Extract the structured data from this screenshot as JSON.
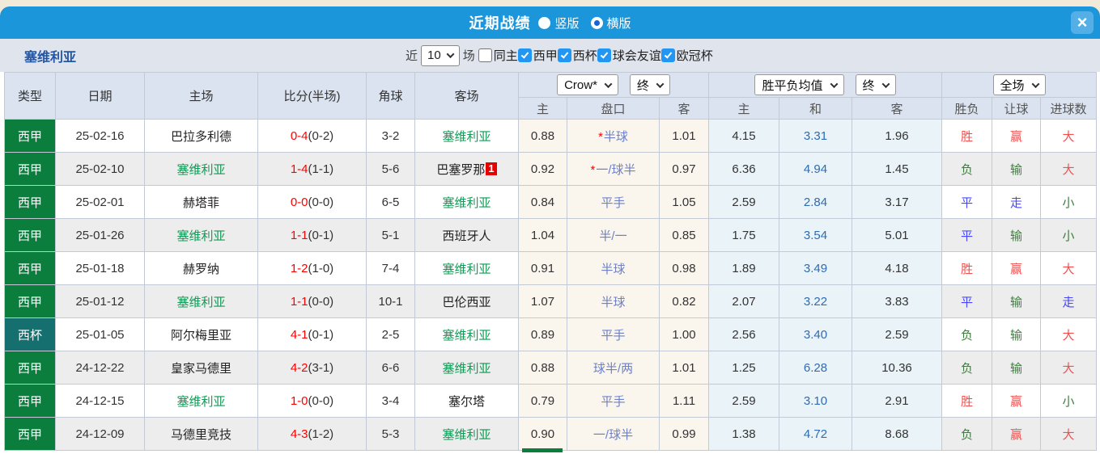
{
  "colors": {
    "titlebar_bg": "#1c96da",
    "close_bg": "#54afe6",
    "filter_bg": "#e0e4ed",
    "header_bg": "#dae3ef",
    "row_alt_bg": "#ededed",
    "ah_col_bg": "#faf6ee",
    "avg_col_bg": "#e9f3f8",
    "league_bg": "#0b7d3c",
    "cup_bg": "#156f6e",
    "team_green": "#119a55",
    "team_blue": "#2456a6",
    "score_red": "#ff0000",
    "star_red": "#ff0000",
    "handicap_blue": "#6d80c8",
    "avg_draw_blue": "#2f6cb3",
    "res_red": "#f34f4f",
    "res_green": "#3e7d3e",
    "res_blue": "#4646ff",
    "badge_red": "#e60000",
    "check_blue": "#2196f3",
    "radio_dot_blue": "#1565d8"
  },
  "titlebar": {
    "title": "近期战绩",
    "radios": [
      {
        "label": "竖版",
        "selected": false
      },
      {
        "label": "横版",
        "selected": true
      }
    ],
    "close_label": "×"
  },
  "filter": {
    "team": "塞维利亚",
    "recent_label": "近",
    "recent_value": "10",
    "matches_label": "场",
    "same_home": {
      "label": "同主",
      "checked": false
    },
    "leagues": [
      {
        "label": "西甲",
        "checked": true
      },
      {
        "label": "西杯",
        "checked": true
      },
      {
        "label": "球会友谊",
        "checked": true
      },
      {
        "label": "欧冠杯",
        "checked": true
      }
    ]
  },
  "table": {
    "static_headers": [
      "类型",
      "日期",
      "主场",
      "比分(半场)",
      "角球",
      "客场"
    ],
    "ah_group": {
      "company": "Crow*",
      "time": "终",
      "subs": [
        "主",
        "盘口",
        "客"
      ]
    },
    "avg_group": {
      "label": "胜平负均值",
      "time": "终",
      "subs": [
        "主",
        "和",
        "客"
      ]
    },
    "result_group": {
      "scope": "全场",
      "subs": [
        "胜负",
        "让球",
        "进球数"
      ]
    },
    "rows": [
      {
        "type": {
          "label": "西甲",
          "kind": "league"
        },
        "date": "25-02-16",
        "home": {
          "name": "巴拉多利德",
          "highlight": false
        },
        "score": {
          "full": "0-4",
          "half": "(0-2)"
        },
        "corners": "3-2",
        "away": {
          "name": "塞维利亚",
          "highlight": true,
          "badge": ""
        },
        "odds": {
          "home": "0.88",
          "line": "半球",
          "star": true,
          "away": "1.01"
        },
        "avg": {
          "home": "4.15",
          "draw": "3.31",
          "away": "1.96"
        },
        "result": {
          "wdl": {
            "t": "胜",
            "c": "red"
          },
          "ah": {
            "t": "赢",
            "c": "red"
          },
          "goal": {
            "t": "大",
            "c": "red"
          }
        }
      },
      {
        "type": {
          "label": "西甲",
          "kind": "league"
        },
        "date": "25-02-10",
        "home": {
          "name": "塞维利亚",
          "highlight": true
        },
        "score": {
          "full": "1-4",
          "half": "(1-1)"
        },
        "corners": "5-6",
        "away": {
          "name": "巴塞罗那",
          "highlight": false,
          "badge": "1"
        },
        "odds": {
          "home": "0.92",
          "line": "一/球半",
          "star": true,
          "away": "0.97"
        },
        "avg": {
          "home": "6.36",
          "draw": "4.94",
          "away": "1.45"
        },
        "result": {
          "wdl": {
            "t": "负",
            "c": "green"
          },
          "ah": {
            "t": "输",
            "c": "green"
          },
          "goal": {
            "t": "大",
            "c": "red"
          }
        }
      },
      {
        "type": {
          "label": "西甲",
          "kind": "league"
        },
        "date": "25-02-01",
        "home": {
          "name": "赫塔菲",
          "highlight": false
        },
        "score": {
          "full": "0-0",
          "half": "(0-0)"
        },
        "corners": "6-5",
        "away": {
          "name": "塞维利亚",
          "highlight": true,
          "badge": ""
        },
        "odds": {
          "home": "0.84",
          "line": "平手",
          "star": false,
          "away": "1.05"
        },
        "avg": {
          "home": "2.59",
          "draw": "2.84",
          "away": "3.17"
        },
        "result": {
          "wdl": {
            "t": "平",
            "c": "blue"
          },
          "ah": {
            "t": "走",
            "c": "blue"
          },
          "goal": {
            "t": "小",
            "c": "green"
          }
        }
      },
      {
        "type": {
          "label": "西甲",
          "kind": "league"
        },
        "date": "25-01-26",
        "home": {
          "name": "塞维利亚",
          "highlight": true
        },
        "score": {
          "full": "1-1",
          "half": "(0-1)"
        },
        "corners": "5-1",
        "away": {
          "name": "西班牙人",
          "highlight": false,
          "badge": ""
        },
        "odds": {
          "home": "1.04",
          "line": "半/一",
          "star": false,
          "away": "0.85"
        },
        "avg": {
          "home": "1.75",
          "draw": "3.54",
          "away": "5.01"
        },
        "result": {
          "wdl": {
            "t": "平",
            "c": "blue"
          },
          "ah": {
            "t": "输",
            "c": "green"
          },
          "goal": {
            "t": "小",
            "c": "green"
          }
        }
      },
      {
        "type": {
          "label": "西甲",
          "kind": "league"
        },
        "date": "25-01-18",
        "home": {
          "name": "赫罗纳",
          "highlight": false
        },
        "score": {
          "full": "1-2",
          "half": "(1-0)"
        },
        "corners": "7-4",
        "away": {
          "name": "塞维利亚",
          "highlight": true,
          "badge": ""
        },
        "odds": {
          "home": "0.91",
          "line": "半球",
          "star": false,
          "away": "0.98"
        },
        "avg": {
          "home": "1.89",
          "draw": "3.49",
          "away": "4.18"
        },
        "result": {
          "wdl": {
            "t": "胜",
            "c": "red"
          },
          "ah": {
            "t": "赢",
            "c": "red"
          },
          "goal": {
            "t": "大",
            "c": "red"
          }
        }
      },
      {
        "type": {
          "label": "西甲",
          "kind": "league"
        },
        "date": "25-01-12",
        "home": {
          "name": "塞维利亚",
          "highlight": true
        },
        "score": {
          "full": "1-1",
          "half": "(0-0)"
        },
        "corners": "10-1",
        "away": {
          "name": "巴伦西亚",
          "highlight": false,
          "badge": ""
        },
        "odds": {
          "home": "1.07",
          "line": "半球",
          "star": false,
          "away": "0.82"
        },
        "avg": {
          "home": "2.07",
          "draw": "3.22",
          "away": "3.83"
        },
        "result": {
          "wdl": {
            "t": "平",
            "c": "blue"
          },
          "ah": {
            "t": "输",
            "c": "green"
          },
          "goal": {
            "t": "走",
            "c": "blue"
          }
        }
      },
      {
        "type": {
          "label": "西杯",
          "kind": "cup"
        },
        "date": "25-01-05",
        "home": {
          "name": "阿尔梅里亚",
          "highlight": false
        },
        "score": {
          "full": "4-1",
          "half": "(0-1)"
        },
        "corners": "2-5",
        "away": {
          "name": "塞维利亚",
          "highlight": true,
          "badge": ""
        },
        "odds": {
          "home": "0.89",
          "line": "平手",
          "star": false,
          "away": "1.00"
        },
        "avg": {
          "home": "2.56",
          "draw": "3.40",
          "away": "2.59"
        },
        "result": {
          "wdl": {
            "t": "负",
            "c": "green"
          },
          "ah": {
            "t": "输",
            "c": "green"
          },
          "goal": {
            "t": "大",
            "c": "red"
          }
        }
      },
      {
        "type": {
          "label": "西甲",
          "kind": "league"
        },
        "date": "24-12-22",
        "home": {
          "name": "皇家马德里",
          "highlight": false
        },
        "score": {
          "full": "4-2",
          "half": "(3-1)"
        },
        "corners": "6-6",
        "away": {
          "name": "塞维利亚",
          "highlight": true,
          "badge": ""
        },
        "odds": {
          "home": "0.88",
          "line": "球半/两",
          "star": false,
          "away": "1.01"
        },
        "avg": {
          "home": "1.25",
          "draw": "6.28",
          "away": "10.36"
        },
        "result": {
          "wdl": {
            "t": "负",
            "c": "green"
          },
          "ah": {
            "t": "输",
            "c": "green"
          },
          "goal": {
            "t": "大",
            "c": "red"
          }
        }
      },
      {
        "type": {
          "label": "西甲",
          "kind": "league"
        },
        "date": "24-12-15",
        "home": {
          "name": "塞维利亚",
          "highlight": true
        },
        "score": {
          "full": "1-0",
          "half": "(0-0)"
        },
        "corners": "3-4",
        "away": {
          "name": "塞尔塔",
          "highlight": false,
          "badge": ""
        },
        "odds": {
          "home": "0.79",
          "line": "平手",
          "star": false,
          "away": "1.11"
        },
        "avg": {
          "home": "2.59",
          "draw": "3.10",
          "away": "2.91"
        },
        "result": {
          "wdl": {
            "t": "胜",
            "c": "red"
          },
          "ah": {
            "t": "赢",
            "c": "red"
          },
          "goal": {
            "t": "小",
            "c": "green"
          }
        }
      },
      {
        "type": {
          "label": "西甲",
          "kind": "league"
        },
        "date": "24-12-09",
        "home": {
          "name": "马德里竞技",
          "highlight": false
        },
        "score": {
          "full": "4-3",
          "half": "(1-2)"
        },
        "corners": "5-3",
        "away": {
          "name": "塞维利亚",
          "highlight": true,
          "badge": ""
        },
        "odds": {
          "home": "0.90",
          "line": "一/球半",
          "star": false,
          "away": "0.99"
        },
        "avg": {
          "home": "1.38",
          "draw": "4.72",
          "away": "8.68"
        },
        "result": {
          "wdl": {
            "t": "负",
            "c": "green"
          },
          "ah": {
            "t": "赢",
            "c": "red"
          },
          "goal": {
            "t": "大",
            "c": "red"
          }
        }
      }
    ]
  }
}
